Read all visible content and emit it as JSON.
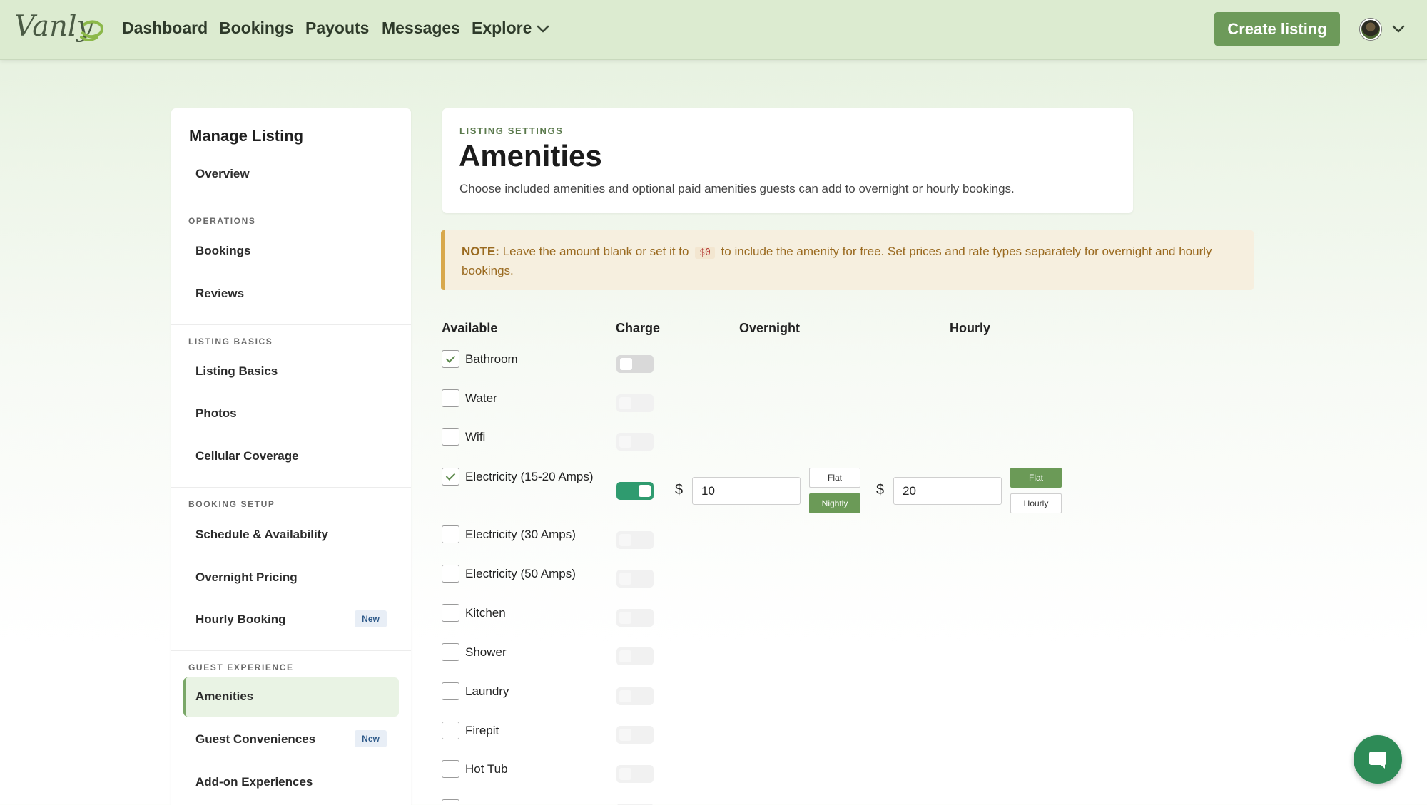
{
  "nav": {
    "brand": "Vanly",
    "links": [
      "Dashboard",
      "Bookings",
      "Payouts",
      "Messages",
      "Explore"
    ],
    "create_listing": "Create listing"
  },
  "sidebar": {
    "title": "Manage Listing",
    "overview": "Overview",
    "sections": [
      {
        "title": "OPERATIONS",
        "items": [
          "Bookings",
          "Reviews"
        ]
      },
      {
        "title": "LISTING BASICS",
        "items": [
          "Listing Basics",
          "Photos",
          "Cellular Coverage"
        ]
      },
      {
        "title": "BOOKING SETUP",
        "items": [
          "Schedule & Availability",
          "Overnight Pricing",
          "Hourly Booking"
        ]
      },
      {
        "title": "GUEST EXPERIENCE",
        "items": [
          "Amenities",
          "Guest Conveniences",
          "Add-on Experiences"
        ]
      }
    ],
    "new_badge": "New",
    "active_item": "Amenities"
  },
  "header": {
    "eyebrow": "LISTING SETTINGS",
    "title": "Amenities",
    "subtitle": "Choose included amenities and optional paid amenities guests can add to overnight or hourly bookings."
  },
  "note": {
    "label": "NOTE:",
    "text_before": "Leave the amount blank or set it to",
    "code": "$0",
    "text_after": "to include the amenity for free. Set prices and rate types separately for overnight and hourly bookings."
  },
  "table": {
    "columns": [
      "Available",
      "Charge",
      "Overnight",
      "Hourly"
    ],
    "currency": "$",
    "rows": [
      {
        "label": "Bathroom",
        "available": true,
        "charge": false
      },
      {
        "label": "Water",
        "available": false,
        "charge": false
      },
      {
        "label": "Wifi",
        "available": false,
        "charge": false
      },
      {
        "label": "Electricity (15-20 Amps)",
        "available": true,
        "charge": true,
        "overnight": {
          "amount": "10",
          "options": [
            "Flat",
            "Nightly"
          ],
          "selected": "Nightly"
        },
        "hourly": {
          "amount": "20",
          "options": [
            "Flat",
            "Hourly"
          ],
          "selected": "Flat"
        }
      },
      {
        "label": "Electricity (30 Amps)",
        "available": false,
        "charge": false
      },
      {
        "label": "Electricity (50 Amps)",
        "available": false,
        "charge": false
      },
      {
        "label": "Kitchen",
        "available": false,
        "charge": false
      },
      {
        "label": "Shower",
        "available": false,
        "charge": false
      },
      {
        "label": "Laundry",
        "available": false,
        "charge": false
      },
      {
        "label": "Firepit",
        "available": false,
        "charge": false
      },
      {
        "label": "Hot Tub",
        "available": false,
        "charge": false
      }
    ]
  },
  "colors": {
    "accent": "#6d9a5a",
    "toggle_on": "#2f9b6f",
    "note_border": "#d8a84c",
    "chat": "#2e8b57"
  }
}
